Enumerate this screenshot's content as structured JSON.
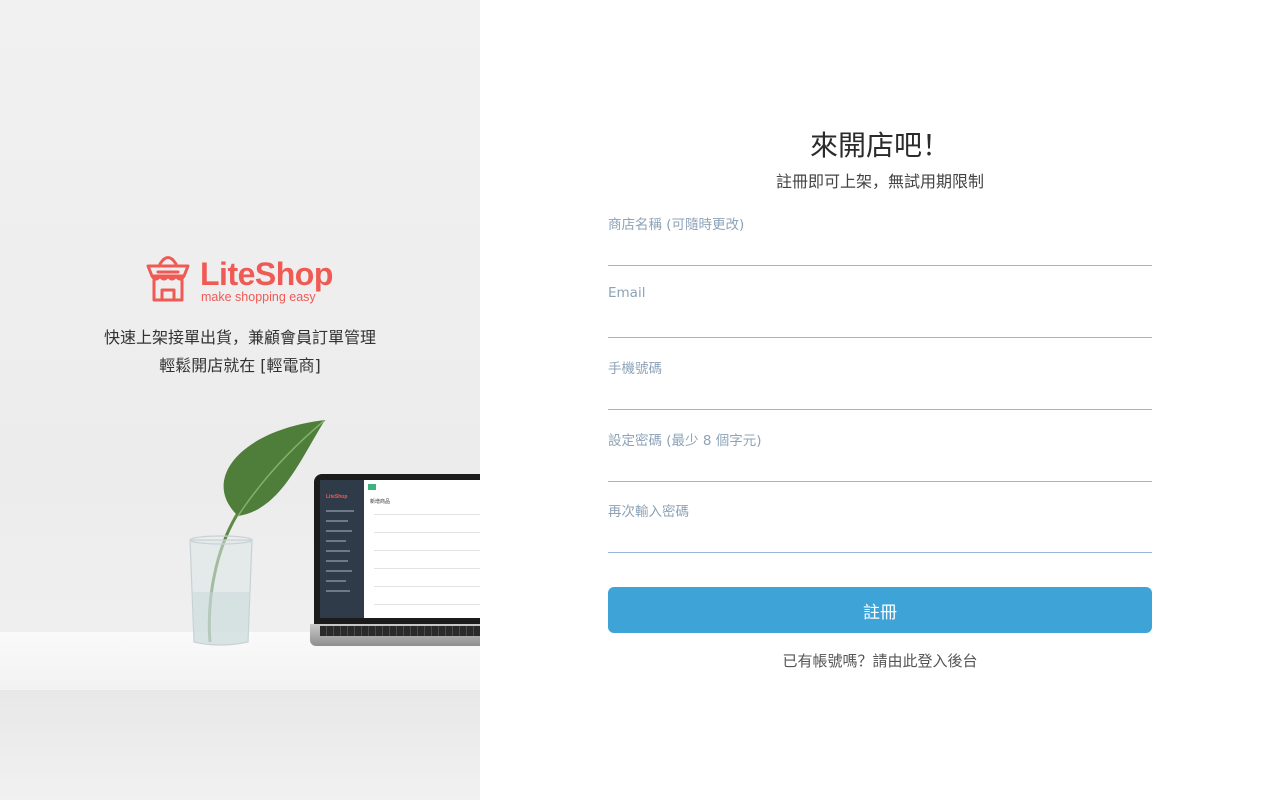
{
  "brand": {
    "name": "LiteShop",
    "tagline": "make shopping easy",
    "color": "#f05a55"
  },
  "intro": {
    "line1": "快速上架接單出貨，兼顧會員訂單管理",
    "line2": "輕鬆開店就在 [輕電商]"
  },
  "laptop_screen": {
    "logo": "LiteShop",
    "page_title": "新增商品"
  },
  "form": {
    "title": "來開店吧！",
    "subtitle": "註冊即可上架，無試用期限制",
    "fields": [
      {
        "label": "商店名稱 (可隨時更改)",
        "value": "",
        "placeholder": ""
      },
      {
        "label": "Email",
        "value": "",
        "placeholder": ""
      },
      {
        "label": "手機號碼",
        "value": "",
        "placeholder": ""
      },
      {
        "label": "設定密碼 (最少 8 個字元)",
        "value": "",
        "placeholder": ""
      },
      {
        "label": "再次輸入密碼",
        "value": "",
        "placeholder": ""
      }
    ],
    "submit_label": "註冊",
    "login_link": "已有帳號嗎？請由此登入後台",
    "accent_color": "#3ea4d8",
    "label_color": "#8ea3b8"
  }
}
